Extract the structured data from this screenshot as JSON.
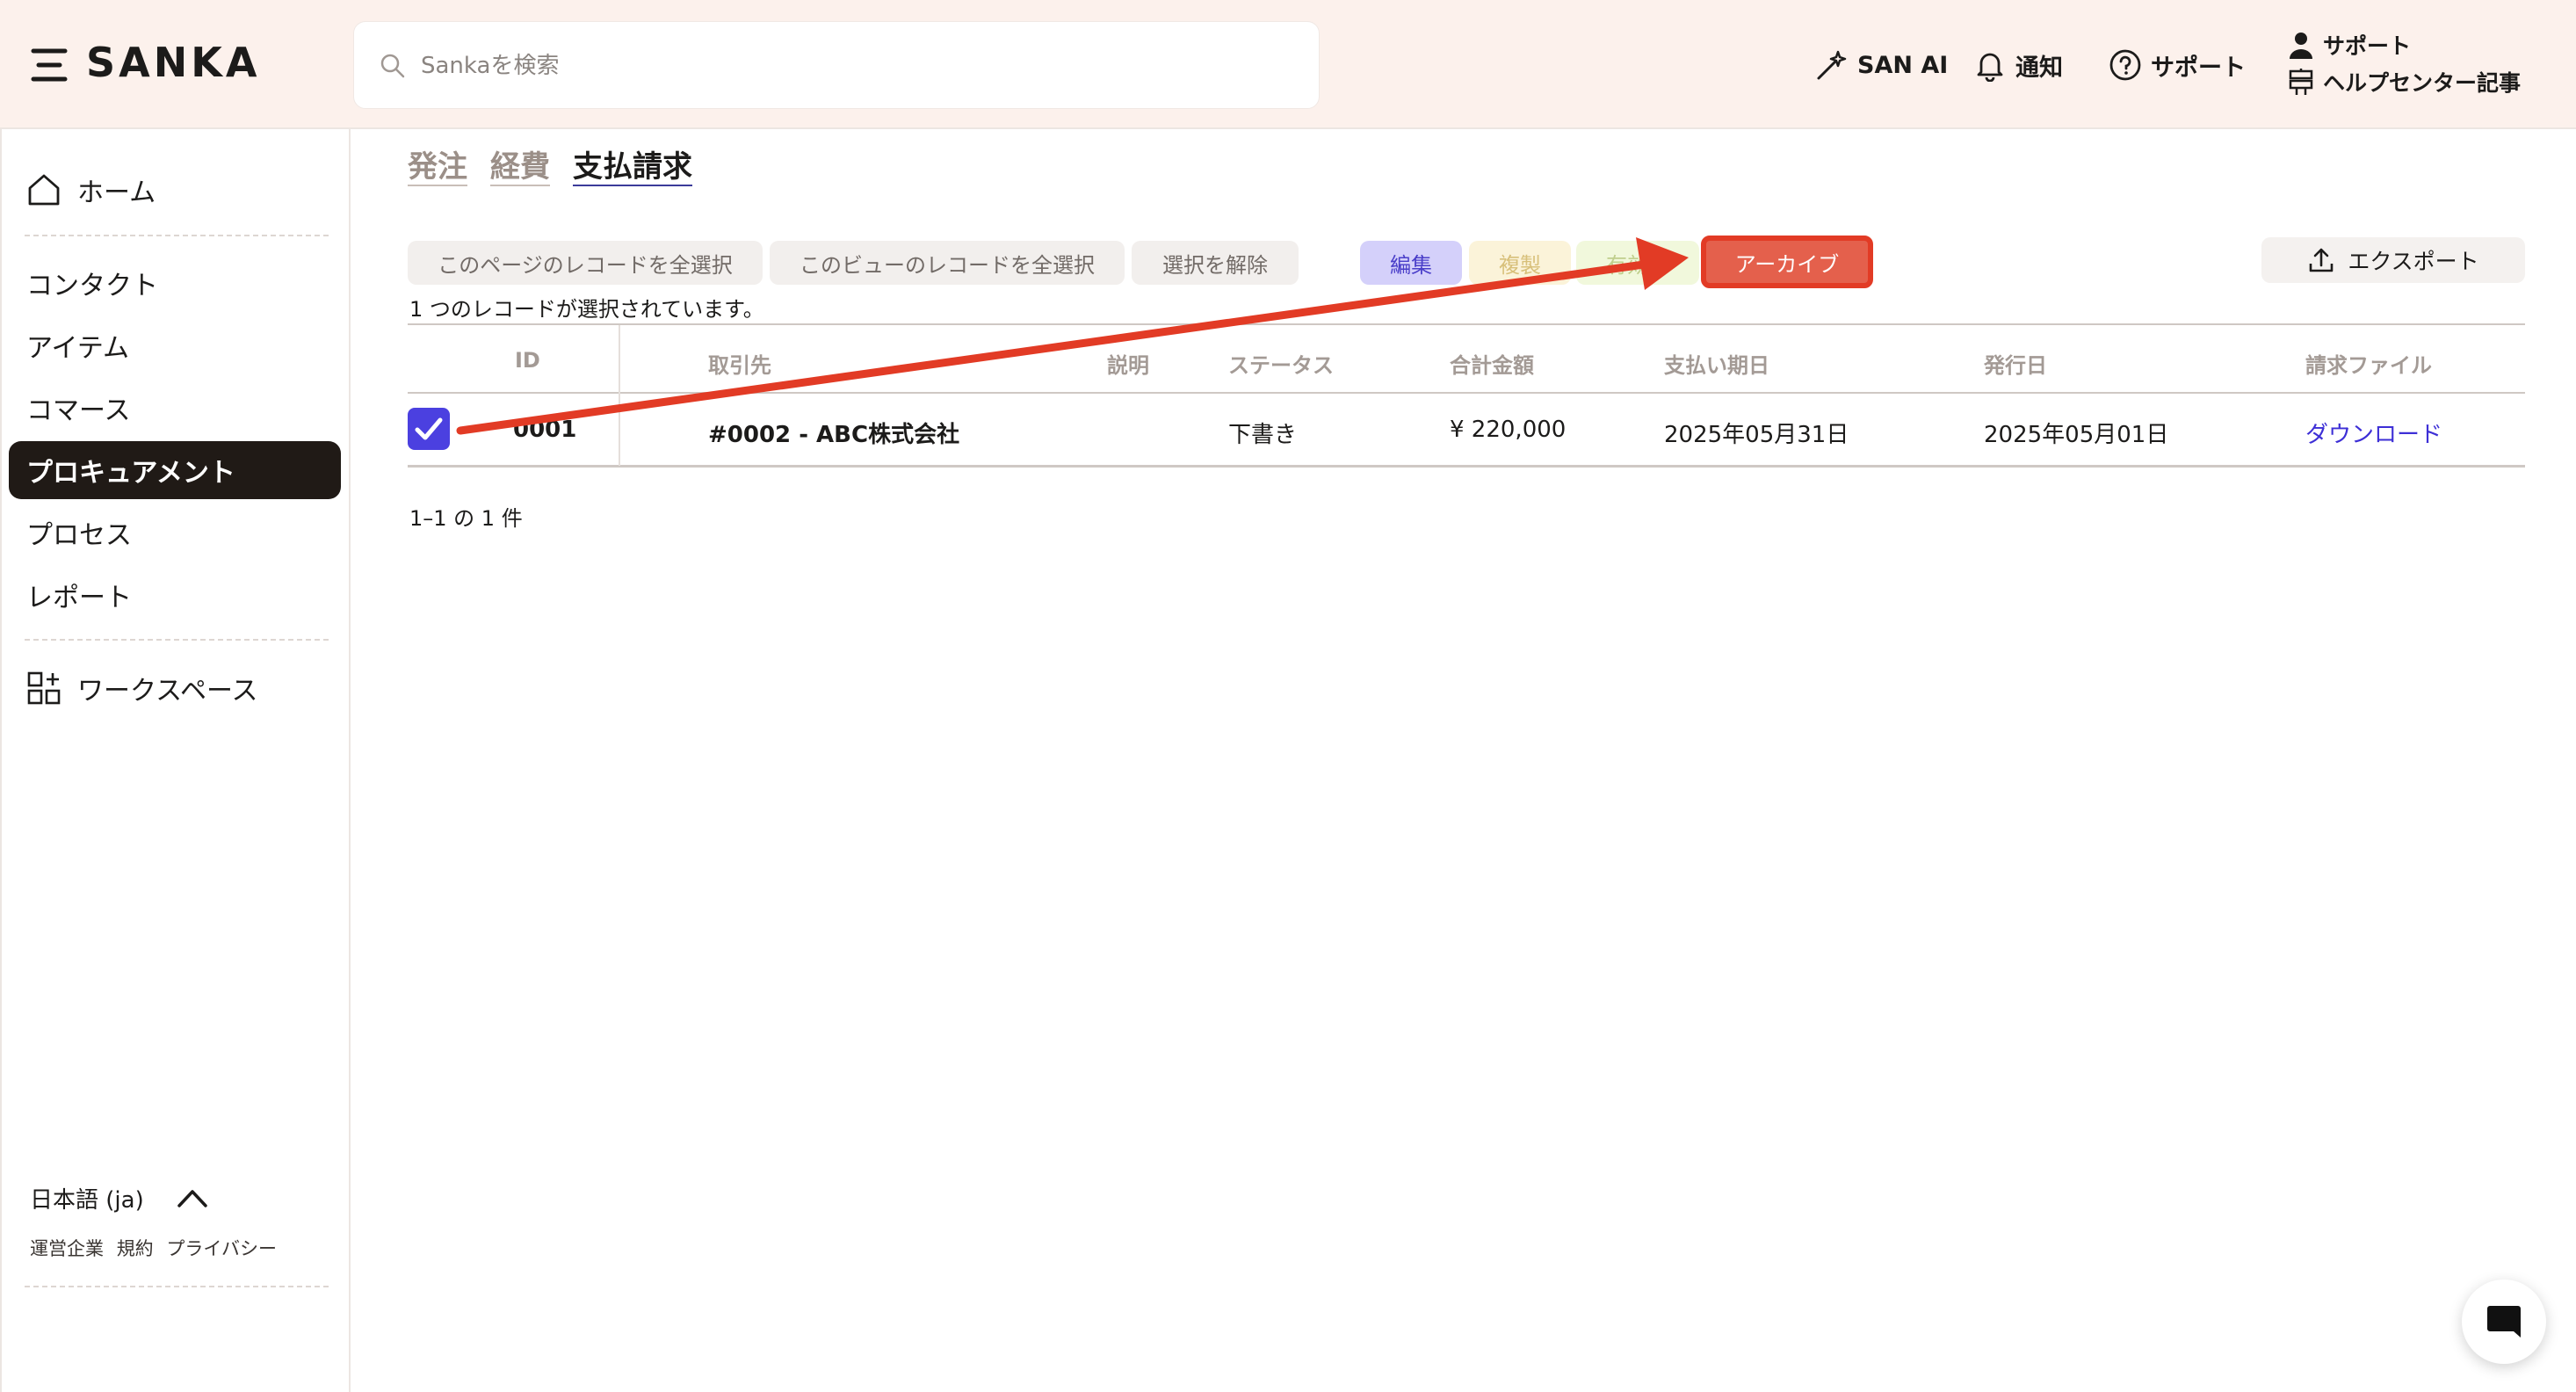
{
  "header": {
    "logo": "SANKA",
    "search_placeholder": "Sankaを検索",
    "san_ai": "SAN AI",
    "notifications": "通知",
    "support": "サポート",
    "support_stack": {
      "support": "サポート",
      "help_articles": "ヘルプセンター記事"
    }
  },
  "sidebar": {
    "home": "ホーム",
    "contacts": "コンタクト",
    "items": "アイテム",
    "commerce": "コマース",
    "procurement": "プロキュアメント",
    "process": "プロセス",
    "reports": "レポート",
    "workspace": "ワークスペース",
    "language": "日本語 (ja)",
    "footer": {
      "company": "運営企業",
      "terms": "規約",
      "privacy": "プライバシー"
    }
  },
  "tabs": [
    {
      "label": "発注",
      "active": false
    },
    {
      "label": "経費",
      "active": false
    },
    {
      "label": "支払請求",
      "active": true
    }
  ],
  "toolbar": {
    "select_page": "このページのレコードを全選択",
    "select_view": "このビューのレコードを全選択",
    "deselect": "選択を解除",
    "edit": "編集",
    "duplicate": "複製",
    "valid": "有効",
    "archive": "アーカイブ",
    "export": "エクスポート"
  },
  "selection_note": "1 つのレコードが選択されています。",
  "table": {
    "columns": [
      "ID",
      "取引先",
      "説明",
      "ステータス",
      "合計金額",
      "支払い期日",
      "発行日",
      "請求ファイル"
    ],
    "rows": [
      {
        "checked": true,
        "id": "0001",
        "partner": "#0002 - ABC株式会社",
        "description": "",
        "status": "下書き",
        "total": "¥ 220,000",
        "due_date": "2025年05月31日",
        "issue_date": "2025年05月01日",
        "file": "ダウンロード"
      }
    ]
  },
  "pager": "1–1 の 1 件",
  "colors": {
    "header_bg": "#fcf1ec",
    "active_nav": "#201a16",
    "accent": "#4b40e0",
    "archive_red": "#e23b25",
    "edit_chip": "#d4d0fa"
  }
}
